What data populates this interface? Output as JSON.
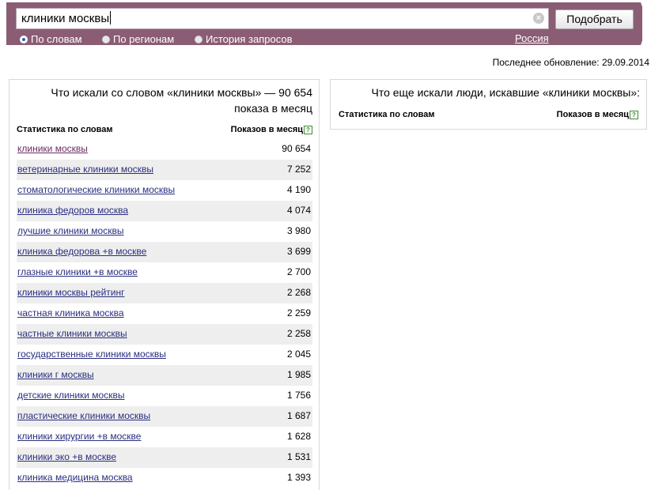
{
  "search": {
    "query": "клиники москвы",
    "submit_label": "Подобрать",
    "clear_symbol": "×",
    "modes": [
      {
        "label": "По словам",
        "checked": true
      },
      {
        "label": "По регионам",
        "checked": false
      },
      {
        "label": "История запросов",
        "checked": false
      }
    ],
    "region": "Россия"
  },
  "last_update": "Последнее обновление: 29.09.2014",
  "left_panel": {
    "title": "Что искали со словом «клиники москвы» — 90 654 показа в месяц",
    "col_keyword": "Статистика по словам",
    "col_count": "Показов в месяц",
    "help": "?",
    "rows": [
      {
        "keyword": "клиники москвы",
        "count": "90 654"
      },
      {
        "keyword": "ветеринарные клиники москвы",
        "count": "7 252"
      },
      {
        "keyword": "стоматологические клиники москвы",
        "count": "4 190"
      },
      {
        "keyword": "клиника федоров москва",
        "count": "4 074"
      },
      {
        "keyword": "лучшие клиники москвы",
        "count": "3 980"
      },
      {
        "keyword": "клиника федорова +в москве",
        "count": "3 699"
      },
      {
        "keyword": "глазные клиники +в москве",
        "count": "2 700"
      },
      {
        "keyword": "клиники москвы рейтинг",
        "count": "2 268"
      },
      {
        "keyword": "частная клиника москва",
        "count": "2 259"
      },
      {
        "keyword": "частные клиники москвы",
        "count": "2 258"
      },
      {
        "keyword": "государственные клиники москвы",
        "count": "2 045"
      },
      {
        "keyword": "клиники г москвы",
        "count": "1 985"
      },
      {
        "keyword": "детские клиники москвы",
        "count": "1 756"
      },
      {
        "keyword": "пластические клиники москвы",
        "count": "1 687"
      },
      {
        "keyword": "клиники хирургии +в москве",
        "count": "1 628"
      },
      {
        "keyword": "клиники эко +в москве",
        "count": "1 531"
      },
      {
        "keyword": "клиника медицина москва",
        "count": "1 393"
      }
    ]
  },
  "right_panel": {
    "title": "Что еще искали люди, искавшие «клиники москвы»:",
    "col_keyword": "Статистика по словам",
    "col_count": "Показов в месяц",
    "help": "?"
  }
}
